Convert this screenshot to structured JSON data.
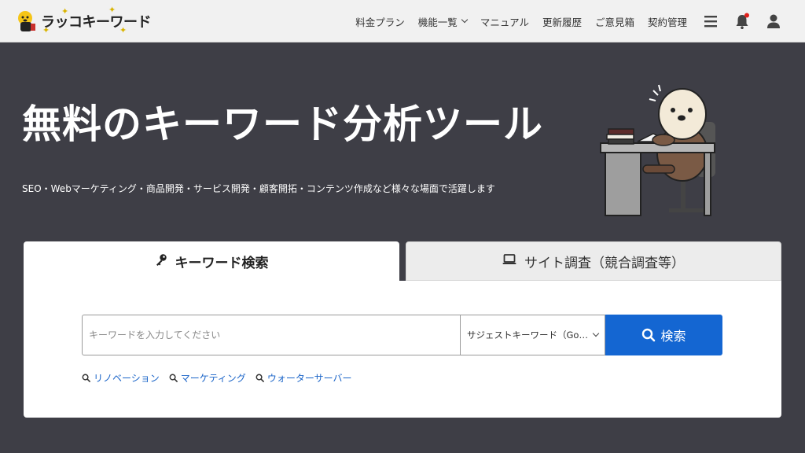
{
  "header": {
    "logo_text": "ラッコキーワード",
    "nav": [
      {
        "label": "料金プラン",
        "has_dropdown": false
      },
      {
        "label": "機能一覧",
        "has_dropdown": true
      },
      {
        "label": "マニュアル",
        "has_dropdown": false
      },
      {
        "label": "更新履歴",
        "has_dropdown": false
      },
      {
        "label": "ご意見箱",
        "has_dropdown": false
      },
      {
        "label": "契約管理",
        "has_dropdown": false
      }
    ],
    "icons": [
      "menu-icon",
      "bell-icon",
      "user-icon"
    ],
    "notification_dot_color": "#e0201b"
  },
  "hero": {
    "title": "無料のキーワード分析ツール",
    "subtitle": "SEO・Webマーケティング・商品開発・サービス開発・顧客開拓・コンテンツ作成など様々な場面で活躍します"
  },
  "tabs": [
    {
      "label": "キーワード検索",
      "icon": "key-icon",
      "active": true
    },
    {
      "label": "サイト調査（競合調査等）",
      "icon": "laptop-icon",
      "active": false
    }
  ],
  "search": {
    "placeholder": "キーワードを入力してください",
    "value": "",
    "select_value": "サジェストキーワード（Goog…",
    "button_label": "検索"
  },
  "suggestions": [
    "リノベーション",
    "マーケティング",
    "ウォーターサーバー"
  ],
  "colors": {
    "background": "#3e3e46",
    "header_bg": "#f1f1f1",
    "accent": "#1466d2",
    "link": "#1a64c8"
  }
}
